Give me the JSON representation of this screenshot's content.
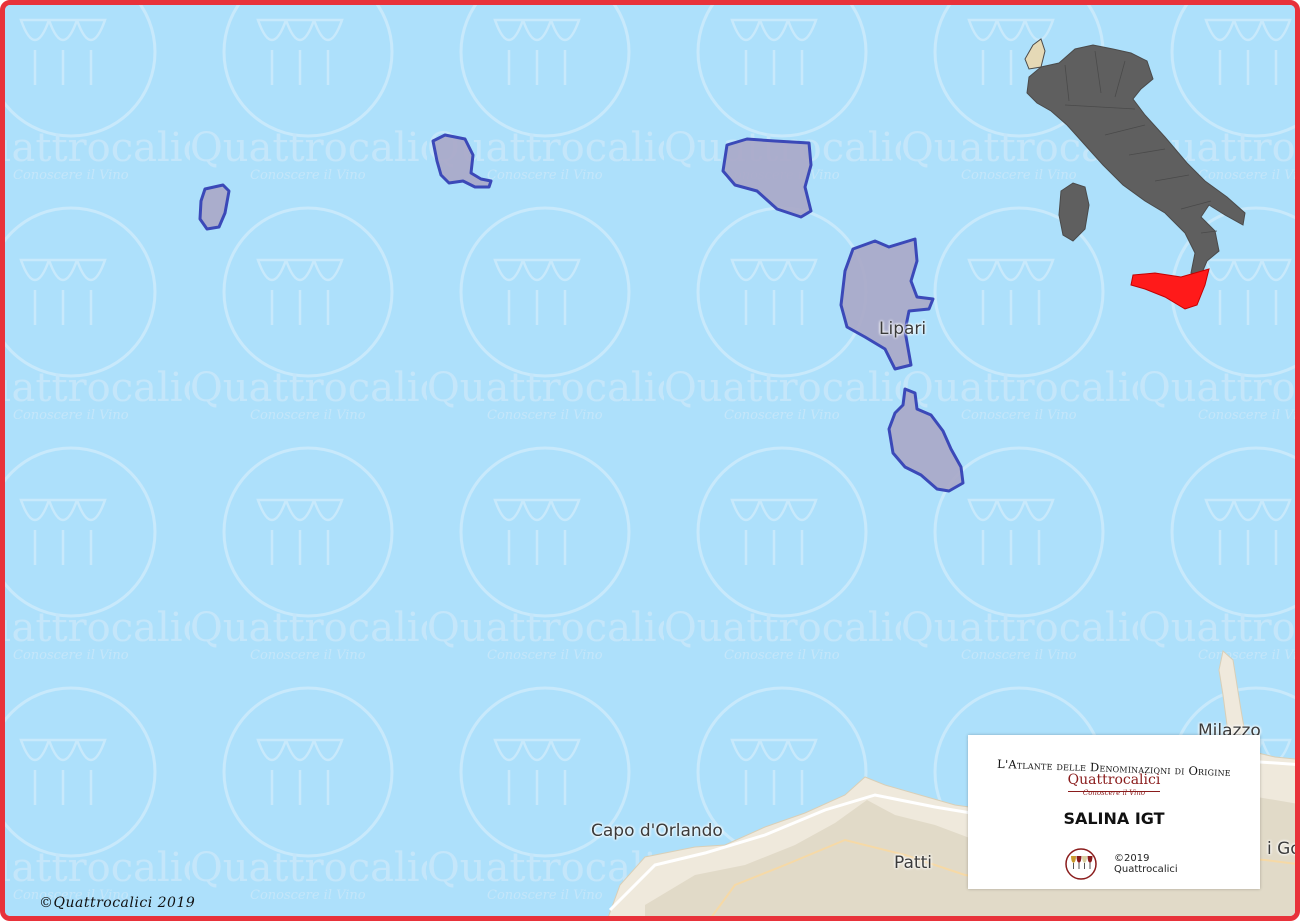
{
  "map": {
    "appellation": "SALINA IGT",
    "region_highlight": "Sicilia",
    "colors": {
      "frame_border": "#e8323a",
      "sea": "#ade0fb",
      "land": "#efe9dc",
      "appellation_fill": "#a9a8c8",
      "appellation_stroke": "#3b49b8",
      "italy_fill": "#5f5f5f",
      "region_highlight": "#ff1a1a",
      "watermark": "#c7e8fb"
    },
    "places": [
      {
        "key": "lipari",
        "label": "Lipari"
      },
      {
        "key": "milazzo",
        "label": "Milazzo"
      },
      {
        "key": "capo_orlando",
        "label": "Capo d'Orlando"
      },
      {
        "key": "patti",
        "label": "Patti"
      },
      {
        "key": "edge",
        "label": "i Go"
      }
    ],
    "watermark_text": "Quattrocalici",
    "watermark_tagline": "Conoscere il Vino"
  },
  "legend": {
    "atlas_title": "L'Atlante delle Denominazioni di Origine",
    "brand_name": "Quattrocalici",
    "brand_tagline": "Conoscere il Vino",
    "appellation": "SALINA IGT",
    "copyright_year": "©2019",
    "copyright_owner": "Quattrocalici",
    "logo_icon": "four-wine-glasses-icon"
  },
  "footer": {
    "credit": "©Quattrocalici 2019"
  }
}
